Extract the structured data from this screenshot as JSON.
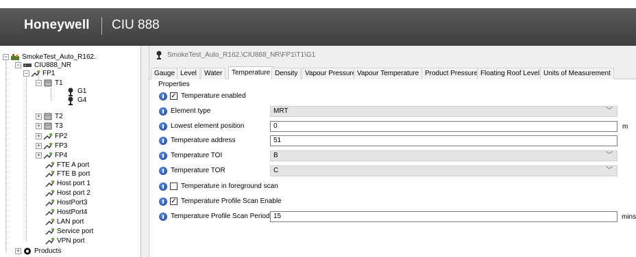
{
  "header": {
    "brand": "Honeywell",
    "app_title": "CIU 888"
  },
  "tree": {
    "items": [
      {
        "label": "SmokeTest_Auto_R162.",
        "expander": "−",
        "icon": "plant-icon"
      },
      {
        "label": "CIU888_NR",
        "expander": "−",
        "icon": "device-icon"
      },
      {
        "label": "FP1",
        "expander": "−",
        "icon": "port-icon"
      },
      {
        "label": "T1",
        "expander": "−",
        "icon": "tank-icon"
      },
      {
        "label": "G1",
        "expander": "",
        "icon": "gauge-icon"
      },
      {
        "label": "G4",
        "expander": "",
        "icon": "gauge-icon"
      },
      {
        "label": "T2",
        "expander": "+",
        "icon": "tank-icon"
      },
      {
        "label": "T3",
        "expander": "+",
        "icon": "tank-icon"
      },
      {
        "label": "FP2",
        "expander": "+",
        "icon": "port-icon"
      },
      {
        "label": "FP3",
        "expander": "+",
        "icon": "port-icon"
      },
      {
        "label": "FP4",
        "expander": "+",
        "icon": "port-icon"
      },
      {
        "label": "FTE A port",
        "expander": "",
        "icon": "port-icon"
      },
      {
        "label": "FTE B port",
        "expander": "",
        "icon": "port-icon"
      },
      {
        "label": "Host port 1",
        "expander": "",
        "icon": "port-icon"
      },
      {
        "label": "Host port 2",
        "expander": "",
        "icon": "port-icon"
      },
      {
        "label": "HostPort3",
        "expander": "",
        "icon": "port-icon"
      },
      {
        "label": "HostPort4",
        "expander": "",
        "icon": "port-icon"
      },
      {
        "label": "LAN port",
        "expander": "",
        "icon": "port-icon"
      },
      {
        "label": "Service port",
        "expander": "",
        "icon": "port-icon"
      },
      {
        "label": "VPN port",
        "expander": "",
        "icon": "port-icon"
      },
      {
        "label": "Products",
        "expander": "+",
        "icon": "products-icon"
      }
    ]
  },
  "path": {
    "text": "SmokeTest_Auto_R162.\\CIU888_NR\\FP1\\T1\\G1"
  },
  "tabs": [
    {
      "label": "Gauge"
    },
    {
      "label": "Level"
    },
    {
      "label": "Water"
    },
    {
      "label": "Temperature"
    },
    {
      "label": "Density"
    },
    {
      "label": "Vapour Pressure"
    },
    {
      "label": "Vapour Temperature"
    },
    {
      "label": "Product Pressure"
    },
    {
      "label": "Floating Roof Level"
    },
    {
      "label": "Units of Measurement"
    }
  ],
  "active_tab": "Temperature",
  "properties": {
    "group_label": "Properties",
    "temperature_enabled": {
      "label": "Temperature enabled",
      "checked": "✓"
    },
    "element_type": {
      "label": "Element type",
      "value": "MRT"
    },
    "lowest_element_position": {
      "label": "Lowest element position",
      "value": "0",
      "unit": "m"
    },
    "temperature_address": {
      "label": "Temperature address",
      "value": "51"
    },
    "temperature_toi": {
      "label": "Temperature TOI",
      "value": "B"
    },
    "temperature_tor": {
      "label": "Temperature TOR",
      "value": "C"
    },
    "foreground_scan": {
      "label": "Temperature in foreground scan",
      "checked": ""
    },
    "profile_scan_enable": {
      "label": "Temperature Profile Scan Enable",
      "checked": "✓"
    },
    "profile_scan_period": {
      "label": "Temperature Profile Scan Period",
      "value": "15",
      "unit": "mins"
    }
  },
  "icons": {
    "combo_arrow": "﹀",
    "info": "info-icon"
  },
  "colors": {
    "header_bg": "#4a4a4a",
    "info_blue": "#1a3f9c"
  }
}
